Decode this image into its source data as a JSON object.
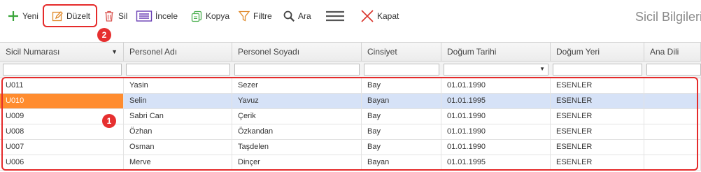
{
  "toolbar": {
    "new_label": "Yeni",
    "edit_label": "Düzelt",
    "delete_label": "Sil",
    "inspect_label": "İncele",
    "copy_label": "Kopya",
    "filter_label": "Filtre",
    "search_label": "Ara",
    "close_label": "Kapat"
  },
  "page_title": "Sicil Bilgileri",
  "badges": {
    "edit": "2",
    "rows": "1"
  },
  "grid": {
    "columns": [
      "Sicil Numarası",
      "Personel Adı",
      "Personel Soyadı",
      "Cinsiyet",
      "Doğum Tarihi",
      "Doğum Yeri",
      "Ana Dili"
    ],
    "rows": [
      [
        "U011",
        "Yasin",
        "Sezer",
        "Bay",
        "01.01.1990",
        "ESENLER",
        ""
      ],
      [
        "U010",
        "Selin",
        "Yavuz",
        "Bayan",
        "01.01.1995",
        "ESENLER",
        ""
      ],
      [
        "U009",
        "Sabri Can",
        "Çerik",
        "Bay",
        "01.01.1990",
        "ESENLER",
        ""
      ],
      [
        "U008",
        "Özhan",
        "Özkandan",
        "Bay",
        "01.01.1990",
        "ESENLER",
        ""
      ],
      [
        "U007",
        "Osman",
        "Taşdelen",
        "Bay",
        "01.01.1990",
        "ESENLER",
        ""
      ],
      [
        "U006",
        "Merve",
        "Dinçer",
        "Bayan",
        "01.01.1995",
        "ESENLER",
        ""
      ]
    ],
    "selected_row": 1
  },
  "colors": {
    "selected_key_cell": "#ff8c2f",
    "selected_row": "#d6e2f7",
    "highlight": "#e52b2b"
  }
}
